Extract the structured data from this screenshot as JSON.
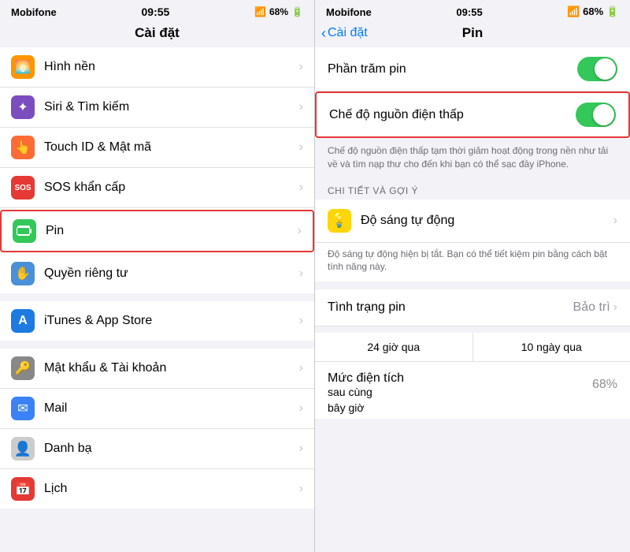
{
  "left": {
    "status": {
      "carrier": "Mobifone",
      "time": "09:55",
      "signal": "📶",
      "battery_pct": "68%"
    },
    "nav_title": "Cài đặt",
    "items": [
      {
        "id": "hinh-nen",
        "label": "Hình nền",
        "icon_color": "orange",
        "icon_char": "🌅"
      },
      {
        "id": "siri",
        "label": "Siri & Tìm kiếm",
        "icon_color": "purple",
        "icon_char": "✦"
      },
      {
        "id": "touch-id",
        "label": "Touch ID & Mật mã",
        "icon_color": "fingerprint",
        "icon_char": "👆"
      },
      {
        "id": "sos",
        "label": "SOS khẩn cấp",
        "icon_color": "red",
        "icon_char": "SOS"
      },
      {
        "id": "pin",
        "label": "Pin",
        "icon_color": "green",
        "icon_char": "🔋",
        "highlighted": true
      },
      {
        "id": "quyen-rieng-tu",
        "label": "Quyền riêng tư",
        "icon_color": "blue-hand",
        "icon_char": "✋"
      },
      {
        "id": "itunes",
        "label": "iTunes & App Store",
        "icon_color": "blue-store",
        "icon_char": "A"
      },
      {
        "id": "mat-khau",
        "label": "Mật khẩu & Tài khoản",
        "icon_color": "gray-key",
        "icon_char": "🔑"
      },
      {
        "id": "mail",
        "label": "Mail",
        "icon_color": "blue-mail",
        "icon_char": "✉"
      },
      {
        "id": "danh-ba",
        "label": "Danh bạ",
        "icon_color": "gray-contact",
        "icon_char": "👤"
      },
      {
        "id": "lich",
        "label": "Lịch",
        "icon_color": "red-cal",
        "icon_char": "📅"
      }
    ]
  },
  "right": {
    "status": {
      "carrier": "Mobifone",
      "time": "09:55",
      "battery_pct": "68%"
    },
    "nav_back": "Cài đặt",
    "nav_title": "Pin",
    "rows": [
      {
        "id": "phan-tram-pin",
        "label": "Phần trăm pin",
        "toggle": true,
        "toggle_on": true
      },
      {
        "id": "che-do-nguon",
        "label": "Chế độ nguồn điện thấp",
        "toggle": true,
        "toggle_on": true,
        "highlighted": true
      }
    ],
    "che_do_desc": "Chế độ nguồn điện thấp tạm thời giảm hoạt động trong nền như tải về và tìm nạp thư cho đến khi bạn có thể sạc đầy iPhone.",
    "chi_tiet_header": "CHI TIẾT VÀ GỢI Ý",
    "do_sang_label": "Độ sáng tự động",
    "do_sang_desc": "Độ sáng tự động hiện bị tắt. Bạn có thể tiết kiệm pin bằng cách bật tính năng này.",
    "tinh_trang_label": "Tình trạng pin",
    "tinh_trang_value": "Bảo trì",
    "tab_24h": "24 giờ qua",
    "tab_10d": "10 ngày qua",
    "muc_dien_label": "Mức điện tích",
    "muc_dien_sub": "sau cùng",
    "muc_dien_sub2": "bây giờ",
    "muc_dien_value": "68%"
  }
}
